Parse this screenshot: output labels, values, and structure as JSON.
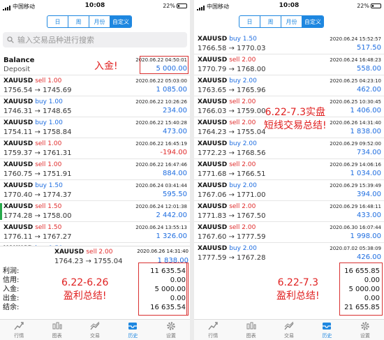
{
  "status": {
    "carrier": "中国移动",
    "time": "10:08",
    "battery": "22%"
  },
  "tabs": [
    "日",
    "周",
    "月份",
    "自定义"
  ],
  "search_placeholder": "输入交易品种进行搜索",
  "left": {
    "balance": {
      "title": "Balance",
      "sub": "Deposit",
      "date": "2020.06.22 04:50:01",
      "amount": "5 000.00"
    },
    "rows": [
      {
        "sym": "XAUUSD",
        "side": "sell 1.00",
        "px": "1756.54 → 1745.69",
        "date": "2020.06.22 05:03:00",
        "pl": "1 085.00"
      },
      {
        "sym": "XAUUSD",
        "side": "buy 1.00",
        "px": "1746.31 → 1748.65",
        "date": "2020.06.22 10:26:26",
        "pl": "234.00"
      },
      {
        "sym": "XAUUSD",
        "side": "buy 1.00",
        "px": "1754.11 → 1758.84",
        "date": "2020.06.22 15:40:28",
        "pl": "473.00"
      },
      {
        "sym": "XAUUSD",
        "side": "sell 1.00",
        "px": "1759.37 → 1761.31",
        "date": "2020.06.22 16:45:19",
        "pl": "-194.00"
      },
      {
        "sym": "XAUUSD",
        "side": "sell 1.00",
        "px": "1760.75 → 1751.91",
        "date": "2020.06.22 16:47:46",
        "pl": "884.00"
      },
      {
        "sym": "XAUUSD",
        "side": "buy 1.50",
        "px": "1770.40 → 1774.37",
        "date": "2020.06.24 03:41:44",
        "pl": "595.50"
      },
      {
        "sym": "XAUUSD",
        "side": "sell 1.50",
        "px": "1774.28 → 1758.00",
        "date": "2020.06.24 12:01:38",
        "pl": "2 442.00"
      },
      {
        "sym": "XAUUSD",
        "side": "sell 1.50",
        "px": "1776.11 → 1767.27",
        "date": "2020.06.24 13:55:13",
        "pl": "1 326.00"
      },
      {
        "sym": "XAUUSD",
        "side": "buy 1.50",
        "px": "1766.58 → 1770.03",
        "date": "2020.06.24 15:52:57",
        "pl": ""
      },
      {
        "sym": "XAUUSD",
        "side": "sell 2.00",
        "px": "1770.79 → 1768.00",
        "date": "",
        "pl": ""
      },
      {
        "sym": "XAUUSD",
        "side": "buy 2.00",
        "px": "1763.65 → 1765.96",
        "date": "",
        "pl": ""
      },
      {
        "sym": "XAUUSD",
        "side": "sell 2.00",
        "px": "1766.03 → 1759.00",
        "date": "",
        "pl": ""
      }
    ],
    "popup": {
      "sym": "XAUUSD",
      "side": "sell 2.00",
      "px": "1764.23 → 1755.04",
      "date": "2020.06.26 14:31:40",
      "pl": "1 838.00"
    },
    "summary_labels": [
      "利润:",
      "信用:",
      "入金:",
      "出金:",
      "结余:"
    ],
    "summary_values": [
      "11 635.54",
      "0.00",
      "5 000.00",
      "0.00",
      "16 635.54"
    ],
    "anno_deposit": "入金!",
    "anno_total": [
      "6.22-6.26",
      "盈利总结!"
    ]
  },
  "right": {
    "rows": [
      {
        "sym": "XAUUSD",
        "side": "buy 1.50",
        "px": "1766.58 → 1770.03",
        "date": "2020.06.24 15:52:57",
        "pl": "517.50"
      },
      {
        "sym": "XAUUSD",
        "side": "sell 2.00",
        "px": "1770.79 → 1768.00",
        "date": "2020.06.24 16:48:23",
        "pl": "558.00"
      },
      {
        "sym": "XAUUSD",
        "side": "buy 2.00",
        "px": "1763.65 → 1765.96",
        "date": "2020.06.25 04:23:10",
        "pl": "462.00"
      },
      {
        "sym": "XAUUSD",
        "side": "sell 2.00",
        "px": "1766.03 → 1759.00",
        "date": "2020.06.25 10:30:45",
        "pl": "1 406.00"
      },
      {
        "sym": "XAUUSD",
        "side": "sell 2.00",
        "px": "1764.23 → 1755.04",
        "date": "2020.06.26 14:31:40",
        "pl": "1 838.00"
      },
      {
        "sym": "XAUUSD",
        "side": "buy 2.00",
        "px": "1772.23 → 1768.56",
        "date": "2020.06.29 09:52:00",
        "pl": "734.00"
      },
      {
        "sym": "XAUUSD",
        "side": "sell 2.00",
        "px": "1771.68 → 1766.51",
        "date": "2020.06.29 14:06:16",
        "pl": "1 034.00"
      },
      {
        "sym": "XAUUSD",
        "side": "buy 2.00",
        "px": "1767.06 → 1771.00",
        "date": "2020.06.29 15:39:49",
        "pl": "394.00"
      },
      {
        "sym": "XAUUSD",
        "side": "sell 2.00",
        "px": "1771.83 → 1767.50",
        "date": "2020.06.29 16:48:11",
        "pl": "433.00"
      },
      {
        "sym": "XAUUSD",
        "side": "sell 2.00",
        "px": "1767.60 → 1777.59",
        "date": "2020.06.30 16:07:44",
        "pl": "1 998.00"
      },
      {
        "sym": "XAUUSD",
        "side": "buy 2.00",
        "px": "1777.59 → 1767.28",
        "date": "2020.07.02 05:38:09",
        "pl": "426.00"
      }
    ],
    "summary_values": [
      "16 655.85",
      "0.00",
      "5 000.00",
      "0.00",
      "21 655.85"
    ],
    "anno_mid": [
      "6.22-7.3实盘",
      "短线交易总结!"
    ],
    "anno_total": [
      "6.22-7.3",
      "盈利总结!"
    ]
  },
  "nav": [
    "行情",
    "图表",
    "交易",
    "历史",
    "设置"
  ],
  "colors": {
    "accent": "#1e87e0",
    "sell": "#e02a2a",
    "buy": "#1e6de0",
    "annotation": "#e02020"
  }
}
